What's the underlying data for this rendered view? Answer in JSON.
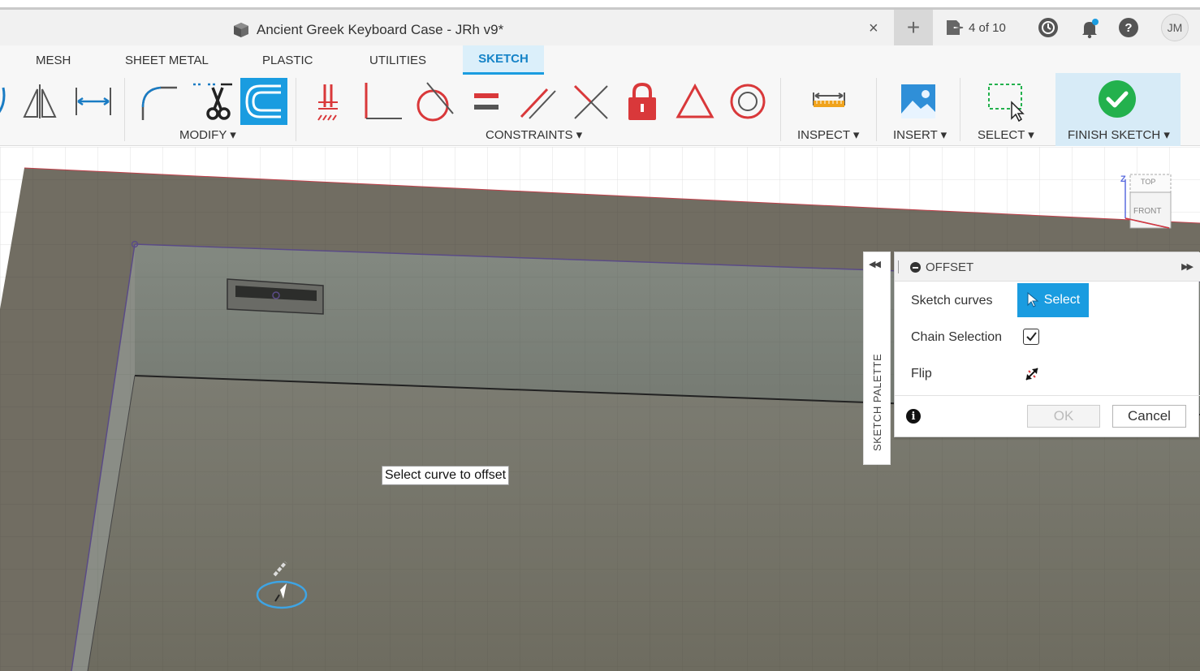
{
  "window": {
    "title": "Ancient Greek Keyboard Case - JRh v9*",
    "jobs_status": "4 of 10",
    "user_initials": "JM",
    "new_tab_symbol": "+",
    "close_symbol": "×"
  },
  "ribbon": {
    "tabs": [
      "MESH",
      "SHEET METAL",
      "PLASTIC",
      "UTILITIES",
      "SKETCH"
    ],
    "active_tab": "SKETCH",
    "groups": {
      "modify": "MODIFY ▾",
      "constraints": "CONSTRAINTS ▾",
      "inspect": "INSPECT ▾",
      "insert": "INSERT ▾",
      "select": "SELECT ▾",
      "finish": "FINISH SKETCH ▾"
    }
  },
  "viewport": {
    "tooltip": "Select curve to offset",
    "viewcube": {
      "top": "TOP",
      "front": "FRONT",
      "z_axis": "Z"
    }
  },
  "palette": {
    "label": "SKETCH PALETTE"
  },
  "offset_dialog": {
    "title": "OFFSET",
    "sketch_curves_label": "Sketch curves",
    "select_button": "Select",
    "chain_selection_label": "Chain Selection",
    "chain_selection_checked": true,
    "flip_label": "Flip",
    "ok_label": "OK",
    "cancel_label": "Cancel"
  },
  "colors": {
    "accent_blue": "#1a9ce0",
    "active_tab_bg": "#dbeffa",
    "constraint_red": "#d9383a",
    "finish_green": "#23b14d"
  }
}
